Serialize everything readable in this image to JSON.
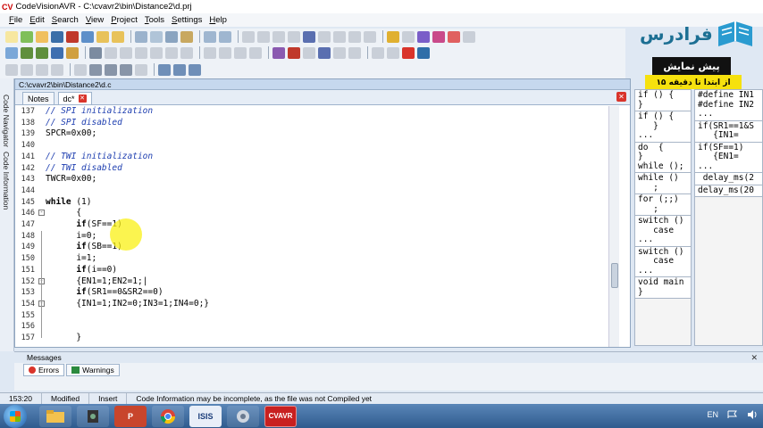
{
  "window": {
    "app_logo": "CV",
    "title": "CodeVisionAVR - C:\\cvavr2\\bin\\Distance2\\d.prj"
  },
  "menu": [
    "File",
    "Edit",
    "Search",
    "View",
    "Project",
    "Tools",
    "Settings",
    "Help"
  ],
  "watermark": {
    "site": "فرادرس",
    "preview": "پیش نمایش",
    "preview_range": "از ابتدا تا دقیقه ۱۵"
  },
  "side_tabs": {
    "navigator": "Code Navigator",
    "information": "Code Information"
  },
  "editor": {
    "path": "C:\\cvavr2\\bin\\Distance2\\d.c",
    "tabs": [
      {
        "label": "Notes"
      },
      {
        "label": "dc*"
      }
    ],
    "lines": [
      {
        "n": "137",
        "parts": [
          {
            "t": "// SPI initialization",
            "c": "cmt"
          }
        ]
      },
      {
        "n": "138",
        "parts": [
          {
            "t": "// SPI disabled",
            "c": "cmt"
          }
        ]
      },
      {
        "n": "139",
        "parts": [
          {
            "t": "SPCR=0x00;",
            "c": "plain"
          }
        ]
      },
      {
        "n": "140",
        "parts": []
      },
      {
        "n": "141",
        "parts": [
          {
            "t": "// TWI initialization",
            "c": "cmt"
          }
        ]
      },
      {
        "n": "142",
        "parts": [
          {
            "t": "// TWI disabled",
            "c": "cmt"
          }
        ]
      },
      {
        "n": "143",
        "parts": [
          {
            "t": "TWCR=0x00;",
            "c": "plain"
          }
        ]
      },
      {
        "n": "144",
        "parts": []
      },
      {
        "n": "145",
        "parts": [
          {
            "t": "while",
            "c": "kw"
          },
          {
            "t": " (1)",
            "c": "plain"
          }
        ]
      },
      {
        "n": "146",
        "fold": "-",
        "parts": [
          {
            "t": "      {",
            "c": "plain"
          }
        ]
      },
      {
        "n": "147",
        "parts": [
          {
            "t": "      ",
            "c": "plain"
          },
          {
            "t": "if",
            "c": "kw"
          },
          {
            "t": "(SF==1)",
            "c": "plain"
          }
        ]
      },
      {
        "n": "148",
        "parts": [
          {
            "t": "      i=0;",
            "c": "plain"
          }
        ]
      },
      {
        "n": "149",
        "parts": [
          {
            "t": "      ",
            "c": "plain"
          },
          {
            "t": "if",
            "c": "kw"
          },
          {
            "t": "(SB==1)",
            "c": "plain"
          }
        ]
      },
      {
        "n": "150",
        "parts": [
          {
            "t": "      i=1;",
            "c": "plain"
          }
        ]
      },
      {
        "n": "151",
        "parts": [
          {
            "t": "      ",
            "c": "plain"
          },
          {
            "t": "if",
            "c": "kw"
          },
          {
            "t": "(i==0)",
            "c": "plain"
          }
        ]
      },
      {
        "n": "152",
        "fold": "-",
        "parts": [
          {
            "t": "      {EN1=1;EN2=1;|",
            "c": "plain"
          }
        ]
      },
      {
        "n": "153",
        "parts": [
          {
            "t": "      ",
            "c": "plain"
          },
          {
            "t": "if",
            "c": "kw"
          },
          {
            "t": "(SR1==0&SR2==0)",
            "c": "plain"
          }
        ]
      },
      {
        "n": "154",
        "fold": "-",
        "parts": [
          {
            "t": "      {IN1=1;IN2=0;IN3=1;IN4=0;}",
            "c": "plain"
          }
        ]
      },
      {
        "n": "155",
        "parts": []
      },
      {
        "n": "156",
        "parts": []
      },
      {
        "n": "157",
        "parts": [
          {
            "t": "      }",
            "c": "plain"
          }
        ]
      }
    ]
  },
  "snippets_left": [
    "if () {\n}",
    "if () {\n   }\n...",
    "do  {\n}\nwhile ();",
    "while ()\n   ;",
    "for (;;)\n   ;",
    "switch ()\n   case\n...",
    "switch ()\n   case\n...",
    "void main\n}"
  ],
  "snippets_right": [
    "#define IN1\n#define IN2\n...",
    "if(SR1==1&S\n   {IN1=",
    "if(SF==1)\n   {EN1=\n...",
    " delay_ms(2",
    "delay_ms(20"
  ],
  "messages": {
    "title": "Messages",
    "tabs": [
      "Errors",
      "Warnings"
    ]
  },
  "status": {
    "position": "153:20",
    "state": "Modified",
    "mode": "Insert",
    "info": "Code Information may be incomplete, as the file was not Compiled yet"
  },
  "taskbar": {
    "items": [
      "folder",
      "camera",
      "P",
      "chrome",
      "ISIS",
      "media",
      "CVAVR"
    ],
    "lang": "EN"
  }
}
